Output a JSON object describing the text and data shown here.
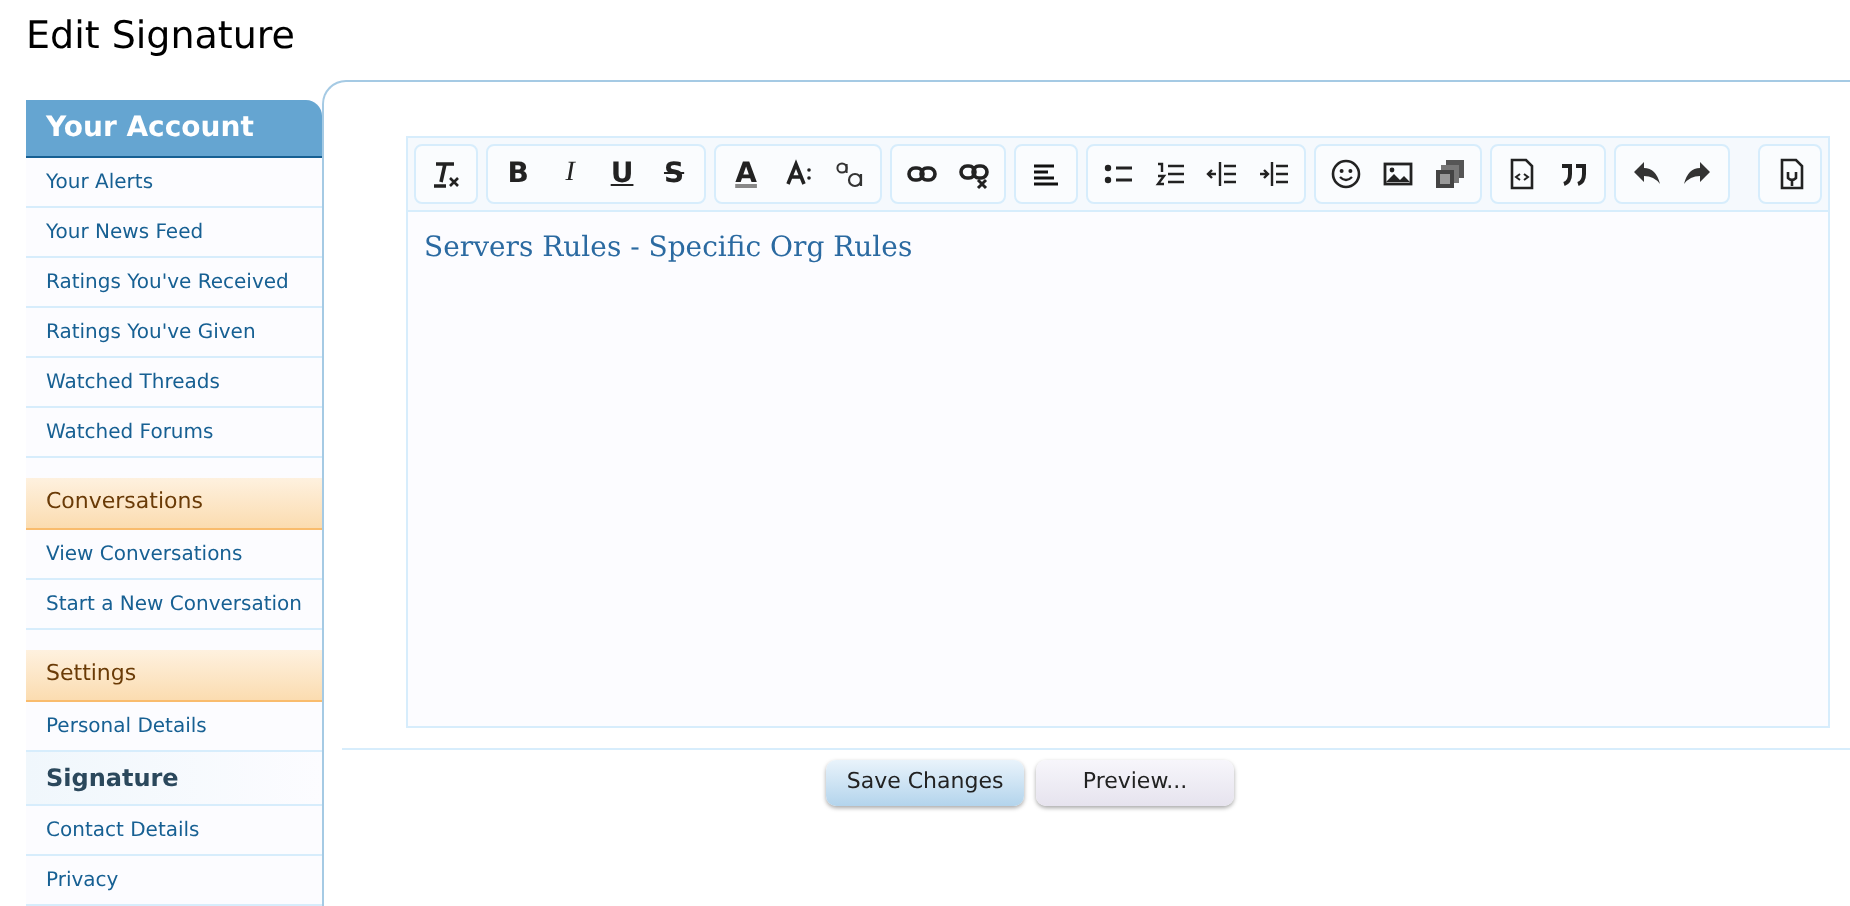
{
  "page": {
    "title": "Edit Signature"
  },
  "sidebar": {
    "sections": [
      {
        "kind": "primary",
        "title": "Your Account",
        "items": [
          {
            "label": "Your Alerts",
            "selected": false
          },
          {
            "label": "Your News Feed",
            "selected": false
          },
          {
            "label": "Ratings You've Received",
            "selected": false
          },
          {
            "label": "Ratings You've Given",
            "selected": false
          },
          {
            "label": "Watched Threads",
            "selected": false
          },
          {
            "label": "Watched Forums",
            "selected": false
          }
        ]
      },
      {
        "kind": "secondary",
        "title": "Conversations",
        "items": [
          {
            "label": "View Conversations",
            "selected": false
          },
          {
            "label": "Start a New Conversation",
            "selected": false
          }
        ]
      },
      {
        "kind": "secondary",
        "title": "Settings",
        "items": [
          {
            "label": "Personal Details",
            "selected": false
          },
          {
            "label": "Signature",
            "selected": true
          },
          {
            "label": "Contact Details",
            "selected": false
          },
          {
            "label": "Privacy",
            "selected": false
          }
        ]
      }
    ]
  },
  "editor": {
    "toolbar": [
      [
        {
          "kind": "remove-format"
        }
      ],
      [
        {
          "kind": "bold",
          "glyph": "B"
        },
        {
          "kind": "italic",
          "glyph": "I"
        },
        {
          "kind": "underline",
          "glyph": "U"
        },
        {
          "kind": "strike",
          "glyph": "S"
        }
      ],
      [
        {
          "kind": "font-color",
          "glyph": "A"
        },
        {
          "kind": "font-size"
        },
        {
          "kind": "font-family"
        }
      ],
      [
        {
          "kind": "link"
        },
        {
          "kind": "unlink"
        }
      ],
      [
        {
          "kind": "align-left"
        }
      ],
      [
        {
          "kind": "bullet-list"
        },
        {
          "kind": "number-list"
        },
        {
          "kind": "outdent"
        },
        {
          "kind": "indent"
        }
      ],
      [
        {
          "kind": "smiley"
        },
        {
          "kind": "image"
        },
        {
          "kind": "media"
        }
      ],
      [
        {
          "kind": "code"
        },
        {
          "kind": "quote"
        }
      ],
      [
        {
          "kind": "undo"
        },
        {
          "kind": "redo"
        }
      ],
      [
        {
          "kind": "source"
        }
      ]
    ],
    "content": "Servers Rules  - Specific Org Rules"
  },
  "buttons": [
    {
      "label": "Save Changes",
      "kind": "primary"
    },
    {
      "label": "Preview...",
      "kind": "secondary"
    }
  ]
}
